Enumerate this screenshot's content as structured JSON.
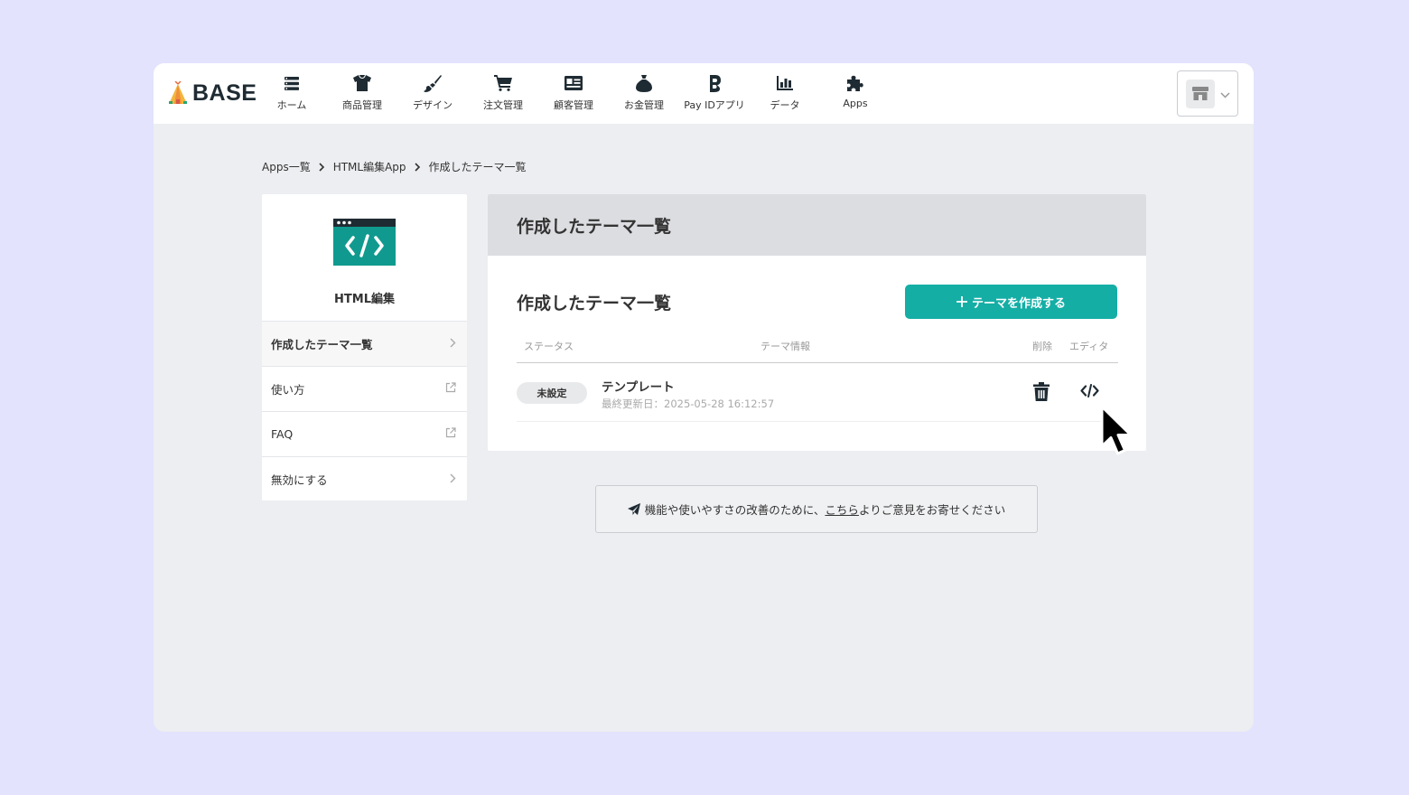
{
  "brand": {
    "name": "BASE"
  },
  "nav": {
    "items": [
      {
        "label": "ホーム",
        "icon": "list-icon"
      },
      {
        "label": "商品管理",
        "icon": "shirt-icon"
      },
      {
        "label": "デザイン",
        "icon": "brush-icon"
      },
      {
        "label": "注文管理",
        "icon": "cart-icon"
      },
      {
        "label": "顧客管理",
        "icon": "id-card-icon"
      },
      {
        "label": "お金管理",
        "icon": "money-bag-icon"
      },
      {
        "label": "Pay IDアプリ",
        "icon": "payid-icon"
      },
      {
        "label": "データ",
        "icon": "bar-chart-icon"
      },
      {
        "label": "Apps",
        "icon": "puzzle-icon"
      }
    ]
  },
  "breadcrumb": {
    "items": [
      "Apps一覧",
      "HTML編集App",
      "作成したテーマ一覧"
    ]
  },
  "sidebar": {
    "app_name": "HTML編集",
    "items": [
      {
        "label": "作成したテーマ一覧",
        "icon": "chevron-right-icon",
        "active": true
      },
      {
        "label": "使い方",
        "icon": "external-link-icon"
      },
      {
        "label": "FAQ",
        "icon": "external-link-icon"
      },
      {
        "label": "無効にする",
        "icon": "chevron-right-icon"
      }
    ]
  },
  "main": {
    "header_title": "作成したテーマ一覧",
    "section_title": "作成したテーマ一覧",
    "create_button": "テーマを作成する",
    "columns": {
      "status": "ステータス",
      "info": "テーマ情報",
      "delete": "削除",
      "editor": "エディタ"
    },
    "rows": [
      {
        "status": "未設定",
        "name": "テンプレート",
        "updated": "最終更新日：2025-05-28 16:12:57"
      }
    ]
  },
  "feedback": {
    "before": "機能や使いやすさの改善のために、",
    "link": "こちら",
    "after": "よりご意見をお寄せください"
  },
  "colors": {
    "accent": "#14aea5",
    "background": "#e3e3fd"
  }
}
